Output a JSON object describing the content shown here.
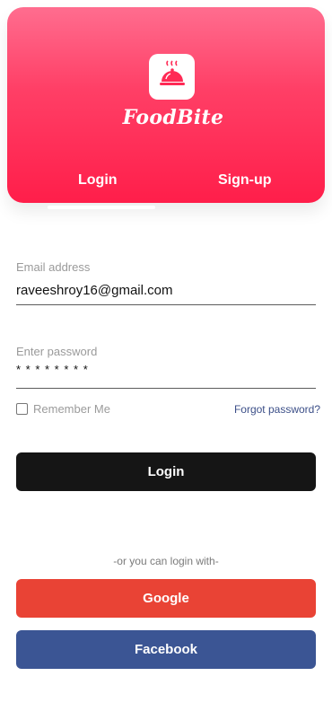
{
  "brand": {
    "name": "FoodBite",
    "logo_icon": "food-cloche-icon",
    "accent": "#ff1e4a"
  },
  "tabs": [
    {
      "label": "Login",
      "active": true
    },
    {
      "label": "Sign-up",
      "active": false
    }
  ],
  "form": {
    "email_label": "Email address",
    "email_value": "raveeshroy16@gmail.com",
    "password_label": "Enter password",
    "password_value": "* * * * * * * *",
    "remember_label": "Remember Me",
    "forgot_label": "Forgot password?"
  },
  "buttons": {
    "login": "Login",
    "google": "Google",
    "facebook": "Facebook"
  },
  "divider_text": "-or you can login with-"
}
